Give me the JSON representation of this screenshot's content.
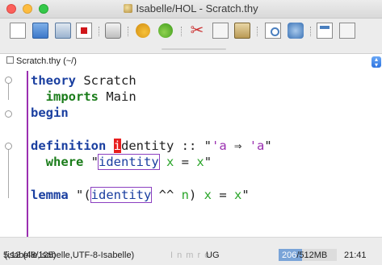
{
  "window": {
    "title": "Isabelle/HOL - Scratch.thy"
  },
  "toolbar": {
    "icons": [
      "new-file-icon",
      "open-file-icon",
      "save-file-icon",
      "close-file-icon",
      "print-icon",
      "undo-icon",
      "redo-icon",
      "cut-icon",
      "copy-icon",
      "paste-icon",
      "find-icon",
      "find-replace-icon",
      "fullscreen-icon",
      "toggle-fullscreen-icon"
    ]
  },
  "buffer": {
    "name": "Scratch.thy (~/)"
  },
  "editor": {
    "line1": {
      "kw": "theory",
      "rest": " Scratch"
    },
    "line2": {
      "kw": "imports",
      "rest": " Main"
    },
    "line3": {
      "kw": "begin"
    },
    "line4": {
      "kw": "definition",
      "cursor_char": "i",
      "ident_rest": "dentity",
      "sep": " :: ",
      "q1": "\"",
      "tv1": "'a",
      "arrow": " ⇒ ",
      "tv2": "'a",
      "q2": "\""
    },
    "line5": {
      "kw": "where",
      "q1": " \"",
      "fn": "identity",
      "var1": " x",
      "eq": " = ",
      "var2": "x",
      "q2": "\""
    },
    "line6": {
      "kw": "lemma",
      "open": " \"(",
      "fn": "identity",
      "op": " ^^ ",
      "var_n": "n",
      "close": ")",
      "var_x1": " x",
      "eq": " = ",
      "var_x2": "x",
      "q2": "\""
    }
  },
  "status": {
    "position": "5,12 (48/125)",
    "mode": "(isabelle,isabelle,UTF-8-Isabelle)",
    "flags": "I n m r o",
    "ug": "UG",
    "mem_used": "206",
    "mem_total": "/512MB",
    "mem_fraction": 0.4,
    "time": "21:41"
  },
  "colors": {
    "keyword": "#1a3fa0",
    "typevar": "#9a2fb0",
    "variable": "#2aa52a",
    "cursor": "#e81e1e",
    "gutter_rule": "#9a2fb0"
  }
}
